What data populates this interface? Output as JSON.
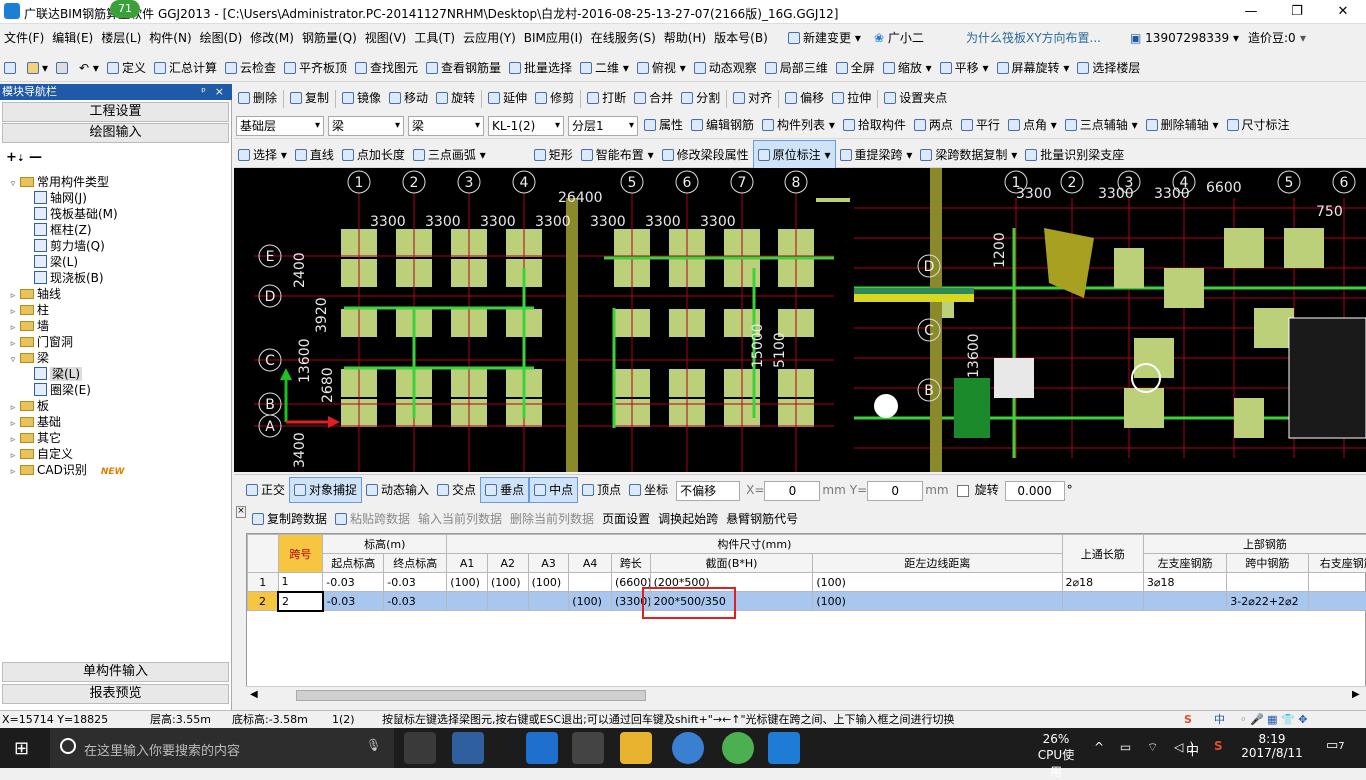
{
  "title": {
    "text": "广联达BIM钢筋算量软件 GGJ2013 - [C:\\Users\\Administrator.PC-20141127NRHM\\Desktop\\白龙村-2016-08-25-13-27-07(2166版)_16G.GGJ12]",
    "badge": "71",
    "min": "—",
    "restore": "❐",
    "close": "✕"
  },
  "menu": {
    "items": [
      "文件(F)",
      "编辑(E)",
      "楼层(L)",
      "构件(N)",
      "绘图(D)",
      "修改(M)",
      "钢筋量(Q)",
      "视图(V)",
      "工具(T)",
      "云应用(Y)",
      "BIM应用(I)",
      "在线服务(S)",
      "帮助(H)",
      "版本号(B)"
    ],
    "new_change": "新建变更",
    "assistant": "广小二",
    "question": "为什么筏板XY方向布置...",
    "phone": "13907298339",
    "price_bean": "造价豆:0"
  },
  "toolbar1": [
    "定义",
    "汇总计算",
    "云检查",
    "平齐板顶",
    "查找图元",
    "查看钢筋量",
    "批量选择",
    "二维",
    "俯视",
    "动态观察",
    "局部三维",
    "全屏",
    "缩放",
    "平移",
    "屏幕旋转",
    "选择楼层"
  ],
  "toolbar2": [
    "删除",
    "复制",
    "镜像",
    "移动",
    "旋转",
    "延伸",
    "修剪",
    "打断",
    "合并",
    "分割",
    "对齐",
    "偏移",
    "拉伸",
    "设置夹点"
  ],
  "toolbar3": {
    "combos": [
      "基础层",
      "梁",
      "梁",
      "KL-1(2)",
      "分层1"
    ],
    "items": [
      "属性",
      "编辑钢筋",
      "构件列表",
      "拾取构件",
      "两点",
      "平行",
      "点角",
      "三点辅轴",
      "删除辅轴",
      "尺寸标注"
    ]
  },
  "toolbar4": [
    "选择",
    "直线",
    "点加长度",
    "三点画弧",
    "矩形",
    "智能布置",
    "修改梁段属性",
    "原位标注",
    "重提梁跨",
    "梁跨数据复制",
    "批量识别梁支座"
  ],
  "nav": {
    "header": "模块导航栏",
    "pin": "ᵖ",
    "close": "×",
    "tab_project": "工程设置",
    "tab_draw": "绘图输入",
    "tree": [
      {
        "label": "常用构件类型",
        "level": 0,
        "exp": "▿",
        "type": "folder"
      },
      {
        "label": "轴网(J)",
        "level": 1,
        "type": "item"
      },
      {
        "label": "筏板基础(M)",
        "level": 1,
        "type": "item"
      },
      {
        "label": "框柱(Z)",
        "level": 1,
        "type": "item"
      },
      {
        "label": "剪力墙(Q)",
        "level": 1,
        "type": "item"
      },
      {
        "label": "梁(L)",
        "level": 1,
        "type": "item"
      },
      {
        "label": "现浇板(B)",
        "level": 1,
        "type": "item"
      },
      {
        "label": "轴线",
        "level": 0,
        "exp": "▹",
        "type": "folder"
      },
      {
        "label": "柱",
        "level": 0,
        "exp": "▹",
        "type": "folder"
      },
      {
        "label": "墙",
        "level": 0,
        "exp": "▹",
        "type": "folder"
      },
      {
        "label": "门窗洞",
        "level": 0,
        "exp": "▹",
        "type": "folder"
      },
      {
        "label": "梁",
        "level": 0,
        "exp": "▿",
        "type": "folder"
      },
      {
        "label": "梁(L)",
        "level": 1,
        "type": "item",
        "selected": true
      },
      {
        "label": "圈梁(E)",
        "level": 1,
        "type": "item"
      },
      {
        "label": "板",
        "level": 0,
        "exp": "▹",
        "type": "folder"
      },
      {
        "label": "基础",
        "level": 0,
        "exp": "▹",
        "type": "folder"
      },
      {
        "label": "其它",
        "level": 0,
        "exp": "▹",
        "type": "folder"
      },
      {
        "label": "自定义",
        "level": 0,
        "exp": "▹",
        "type": "folder"
      },
      {
        "label": "CAD识别",
        "level": 0,
        "exp": "▹",
        "type": "folder",
        "new": "NEW"
      }
    ],
    "btn_single": "单构件输入",
    "btn_report": "报表预览"
  },
  "canvas": {
    "axis_top": [
      "1",
      "2",
      "3",
      "4",
      "5",
      "6",
      "7",
      "8"
    ],
    "axis_left": [
      "E",
      "D",
      "C",
      "B",
      "A"
    ],
    "dims": [
      "26400",
      "3300",
      "3300",
      "3300",
      "3300",
      "3300",
      "3300",
      "3300",
      "2400",
      "3920",
      "13600",
      "2680",
      "3400",
      "15000",
      "5100",
      "13600",
      "6600",
      "3300",
      "3300",
      "3300",
      "750",
      "1200"
    ],
    "right_axis_top": [
      "1",
      "2",
      "3",
      "4",
      "5",
      "6"
    ],
    "right_axis_left": [
      "D",
      "C",
      "B"
    ]
  },
  "snapbar": {
    "items": [
      "正交",
      "对象捕捉",
      "动态输入",
      "交点",
      "垂点",
      "中点",
      "顶点",
      "坐标"
    ],
    "offset": "不偏移",
    "x_label": "X=",
    "x_val": "0",
    "mm1": "mm",
    "y_label": "Y=",
    "y_val": "0",
    "mm2": "mm",
    "rotate": "旋转",
    "rotate_val": "0.000",
    "deg": "°"
  },
  "gridtb": [
    "复制跨数据",
    "粘贴跨数据",
    "输入当前列数据",
    "删除当前列数据",
    "页面设置",
    "调换起始跨",
    "悬臂钢筋代号"
  ],
  "table": {
    "h1": {
      "span": "跨号",
      "elev": "标高(m)",
      "size": "构件尺寸(mm)",
      "through": "上通长筋",
      "top": "上部钢筋"
    },
    "h2": [
      "起点标高",
      "终点标高",
      "A1",
      "A2",
      "A3",
      "A4",
      "跨长",
      "截面(B*H)",
      "距左边线距离",
      "左支座钢筋",
      "跨中钢筋",
      "右支座钢筋"
    ],
    "rows": [
      {
        "idx": "1",
        "span": "1",
        "start": "-0.03",
        "end": "-0.03",
        "a1": "(100)",
        "a2": "(100)",
        "a3": "(100)",
        "a4": "",
        "len": "(6600)",
        "sec": "(200*500)",
        "dist": "(100)",
        "through": "2⌀18",
        "left": "3⌀18",
        "mid": "",
        "right": ""
      },
      {
        "idx": "2",
        "span": "2",
        "start": "-0.03",
        "end": "-0.03",
        "a1": "",
        "a2": "",
        "a3": "",
        "a4": "(100)",
        "len": "(3300)",
        "sec": "200*500/350",
        "dist": "(100)",
        "through": "",
        "left": "",
        "mid": "3-2⌀22+2⌀2",
        "right": ""
      }
    ]
  },
  "status": {
    "coords": "X=15714 Y=18825",
    "floor_h": "层高:3.55m",
    "bottom_h": "底标高:-3.58m",
    "count": "1(2)",
    "hint": "按鼠标左键选择梁图元,按右键或ESC退出;可以通过回车键及shift+\"→←↑\"光标键在跨之间、上下输入框之间进行切换",
    "ime": "中"
  },
  "taskbar": {
    "search": "在这里输入你要搜索的内容",
    "cpu_pct": "26%",
    "cpu_label": "CPU使用",
    "ime": "中",
    "time": "8:19",
    "date": "2017/8/11",
    "notify": "7"
  },
  "colors": {
    "accent": "#1e5aa8",
    "highlight_box": "#e02020",
    "selected_row": "#a9c7ee"
  }
}
